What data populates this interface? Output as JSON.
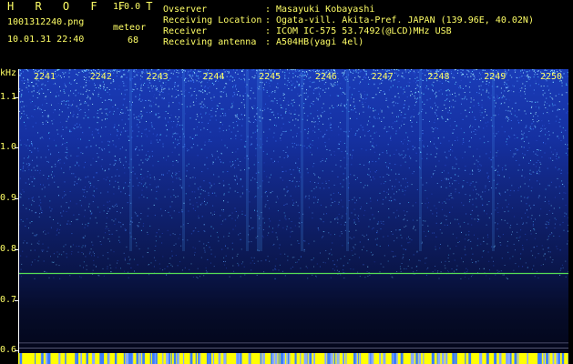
{
  "header": {
    "app_title": "H R O F F T",
    "app_version": "1.0.0",
    "file_name": "1001312240.png",
    "timestamp": "10.01.31 22:40",
    "meteor_label": "meteor",
    "meteor_count": "68"
  },
  "info": [
    {
      "key": "Ovserver",
      "value": "Masayuki Kobayashi"
    },
    {
      "key": "Receiving Location",
      "value": "Ogata-vill. Akita-Pref. JAPAN (139.96E, 40.02N)"
    },
    {
      "key": "Receiver",
      "value": "ICOM IC-575 53.7492(@LCD)MHz USB"
    },
    {
      "key": "Receiving antenna",
      "value": "A504HB(yagi 4el)"
    }
  ],
  "axis": {
    "y_unit": "kHz",
    "y_ticks": [
      "1.1",
      "1.0",
      "0.9",
      "0.8",
      "0.7",
      "0.6"
    ],
    "x_ticks": [
      "2241",
      "2242",
      "2243",
      "2244",
      "2245",
      "2246",
      "2247",
      "2248",
      "2249",
      "2250"
    ]
  },
  "colors": {
    "label": "#ffff66",
    "signal_line": "#55dd55",
    "background": "#000000",
    "bottom_strip": "#ffff00"
  },
  "chart_data": {
    "type": "heatmap",
    "xlabel": "",
    "ylabel": "kHz",
    "x_ticks": [
      2241,
      2242,
      2243,
      2244,
      2245,
      2246,
      2247,
      2248,
      2249,
      2250
    ],
    "y_ticks": [
      1.1,
      1.0,
      0.9,
      0.8,
      0.7,
      0.6
    ],
    "ylim": [
      0.595,
      1.155
    ],
    "reference_line_khz": 0.752,
    "faint_lines_khz": [
      0.615,
      0.605
    ]
  }
}
